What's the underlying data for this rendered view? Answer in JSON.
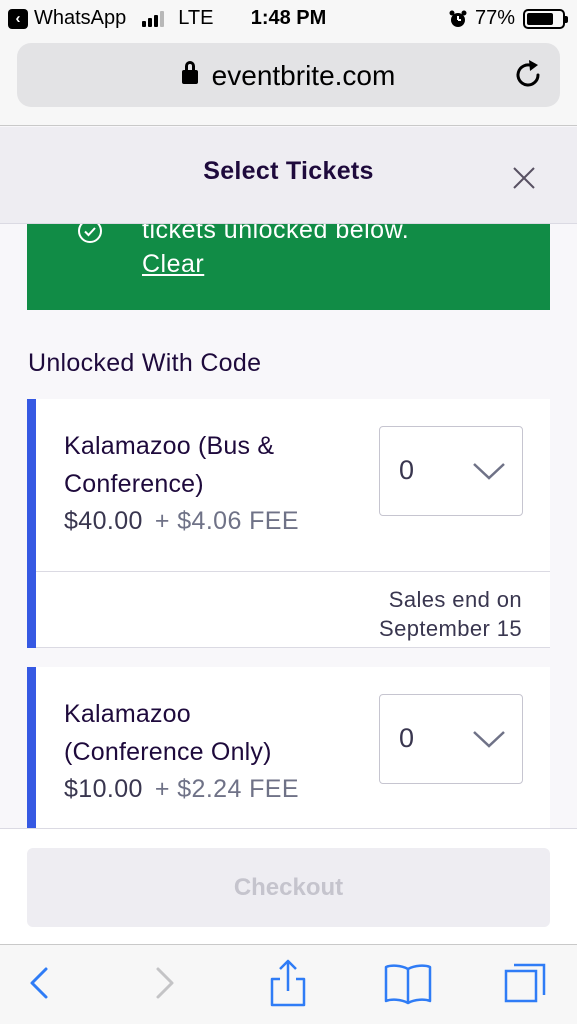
{
  "status_bar": {
    "back_app": "WhatsApp",
    "carrier_network": "LTE",
    "time": "1:48 PM",
    "battery_percent": "77%",
    "battery_level": 0.77,
    "alarm_icon": "alarm-clock-icon"
  },
  "browser": {
    "url": "eventbrite.com",
    "secure_icon": "lock-icon",
    "reload_icon": "reload-icon"
  },
  "modal": {
    "title": "Select Tickets",
    "close_icon": "close-icon"
  },
  "banner": {
    "message": "tickets unlocked below.",
    "clear_label": "Clear",
    "color": "#118c46"
  },
  "section_title": "Unlocked With Code",
  "tickets": [
    {
      "name_line1": "Kalamazoo (Bus &",
      "name_line2": "Conference)",
      "price": "$40.00",
      "fee": "+ $4.06 FEE",
      "quantity": "0",
      "sales_end_line1": "Sales end on",
      "sales_end_line2": "September 15"
    },
    {
      "name_line1": "Kalamazoo",
      "name_line2": "(Conference Only)",
      "price": "$10.00",
      "fee": "+ $2.24 FEE",
      "quantity": "0"
    }
  ],
  "checkout_label": "Checkout",
  "colors": {
    "accent_bar": "#3659e3",
    "title_text": "#1e0a3c",
    "disabled_button": "#eeedf2"
  },
  "toolbar": {
    "icons": [
      "back-icon",
      "forward-icon",
      "share-icon",
      "bookmarks-icon",
      "tabs-icon"
    ]
  }
}
